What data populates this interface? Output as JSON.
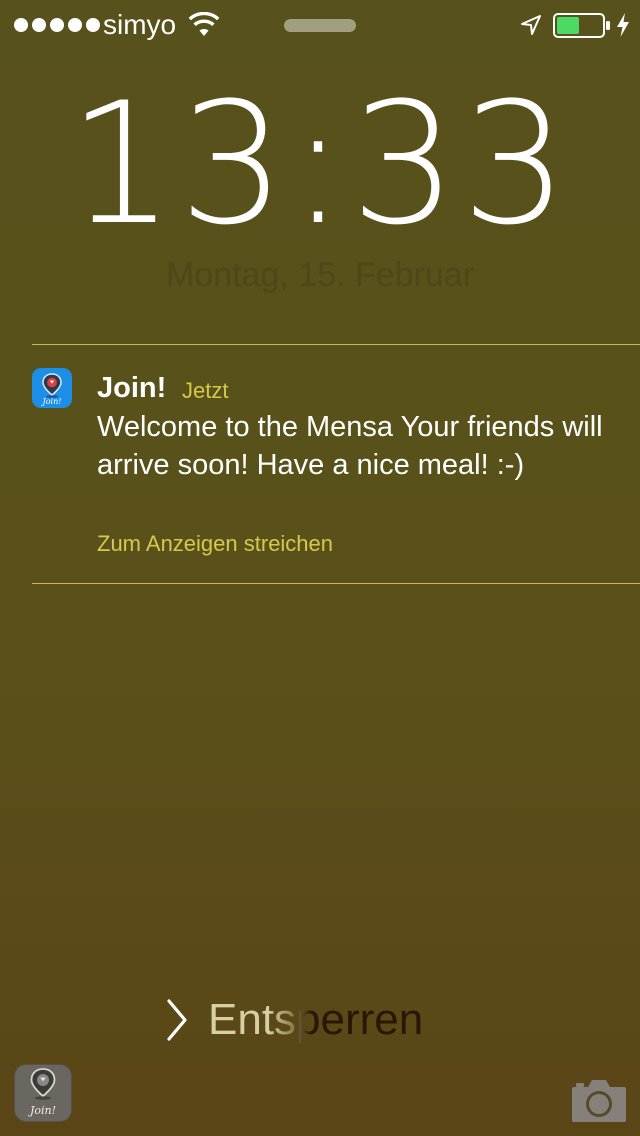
{
  "status_bar": {
    "carrier": "simyo",
    "signal_bars_filled": 5,
    "battery_level": 0.5,
    "charging": true,
    "icons": [
      "wifi-icon",
      "location-arrow-icon",
      "battery-icon",
      "charging-bolt-icon"
    ]
  },
  "lock_screen": {
    "time": "13:33",
    "date": "Montag, 15. Februar"
  },
  "notification": {
    "app_name": "Join!",
    "time_label": "Jetzt",
    "message": "Welcome to the Mensa Your friends will arrive soon! Have a nice meal! :-)",
    "action_hint": "Zum Anzeigen streichen",
    "app_icon_text": "Join!"
  },
  "unlock": {
    "label": "Entsperren"
  },
  "bottom": {
    "app_icon_text": "Join!",
    "camera": "camera-icon"
  },
  "colors": {
    "background_top": "#57511b",
    "background_bottom": "#5a4516",
    "accent_text": "#d4c94c",
    "app_icon_blue": "#1d8fe8",
    "battery_green": "#4cd964"
  }
}
